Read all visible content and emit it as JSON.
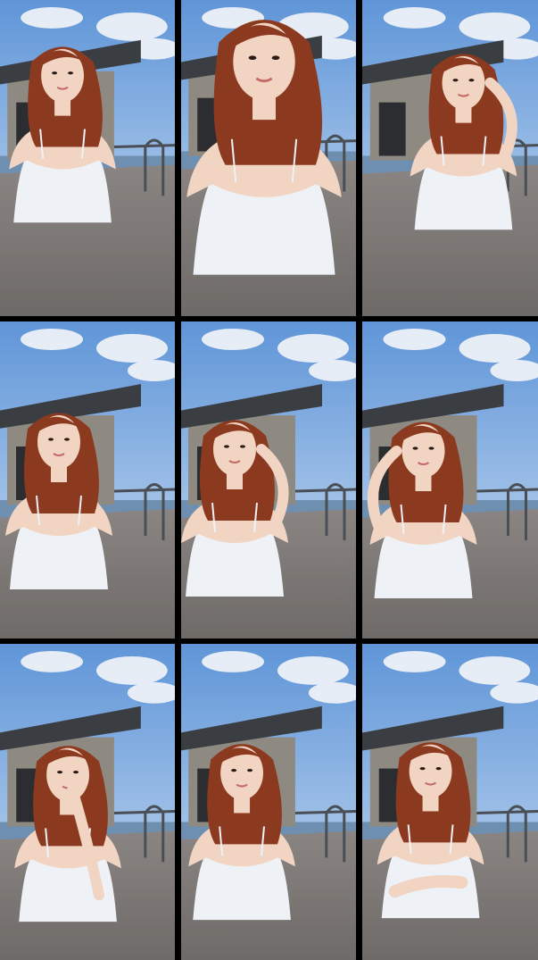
{
  "collage": {
    "rows": 3,
    "cols": 3,
    "frames": [
      {
        "id": "frame-1",
        "pose": "talking",
        "camera": "mid"
      },
      {
        "id": "frame-2",
        "pose": "close-up",
        "camera": "close"
      },
      {
        "id": "frame-3",
        "pose": "hand-in-hair",
        "camera": "mid"
      },
      {
        "id": "frame-4",
        "pose": "smiling",
        "camera": "mid"
      },
      {
        "id": "frame-5",
        "pose": "hand-in-hair",
        "camera": "mid"
      },
      {
        "id": "frame-6",
        "pose": "hand-in-hair-gesture",
        "camera": "mid"
      },
      {
        "id": "frame-7",
        "pose": "hand-to-mouth",
        "camera": "mid"
      },
      {
        "id": "frame-8",
        "pose": "smiling",
        "camera": "mid"
      },
      {
        "id": "frame-9",
        "pose": "hands-on-chest",
        "camera": "mid"
      }
    ]
  },
  "palette": {
    "sky_top": "#5f95d8",
    "sky_bottom": "#cfe1f3",
    "cloud": "#f4f6f9",
    "water": "#6f8fb0",
    "deck": "#6e6a67",
    "roof": "#3a3d42",
    "building": "#8e8a82",
    "hair": "#8b3a20",
    "skin": "#f1d4c2",
    "top": "#eef2f6",
    "rail": "#4a4e55",
    "border": "#000000"
  }
}
